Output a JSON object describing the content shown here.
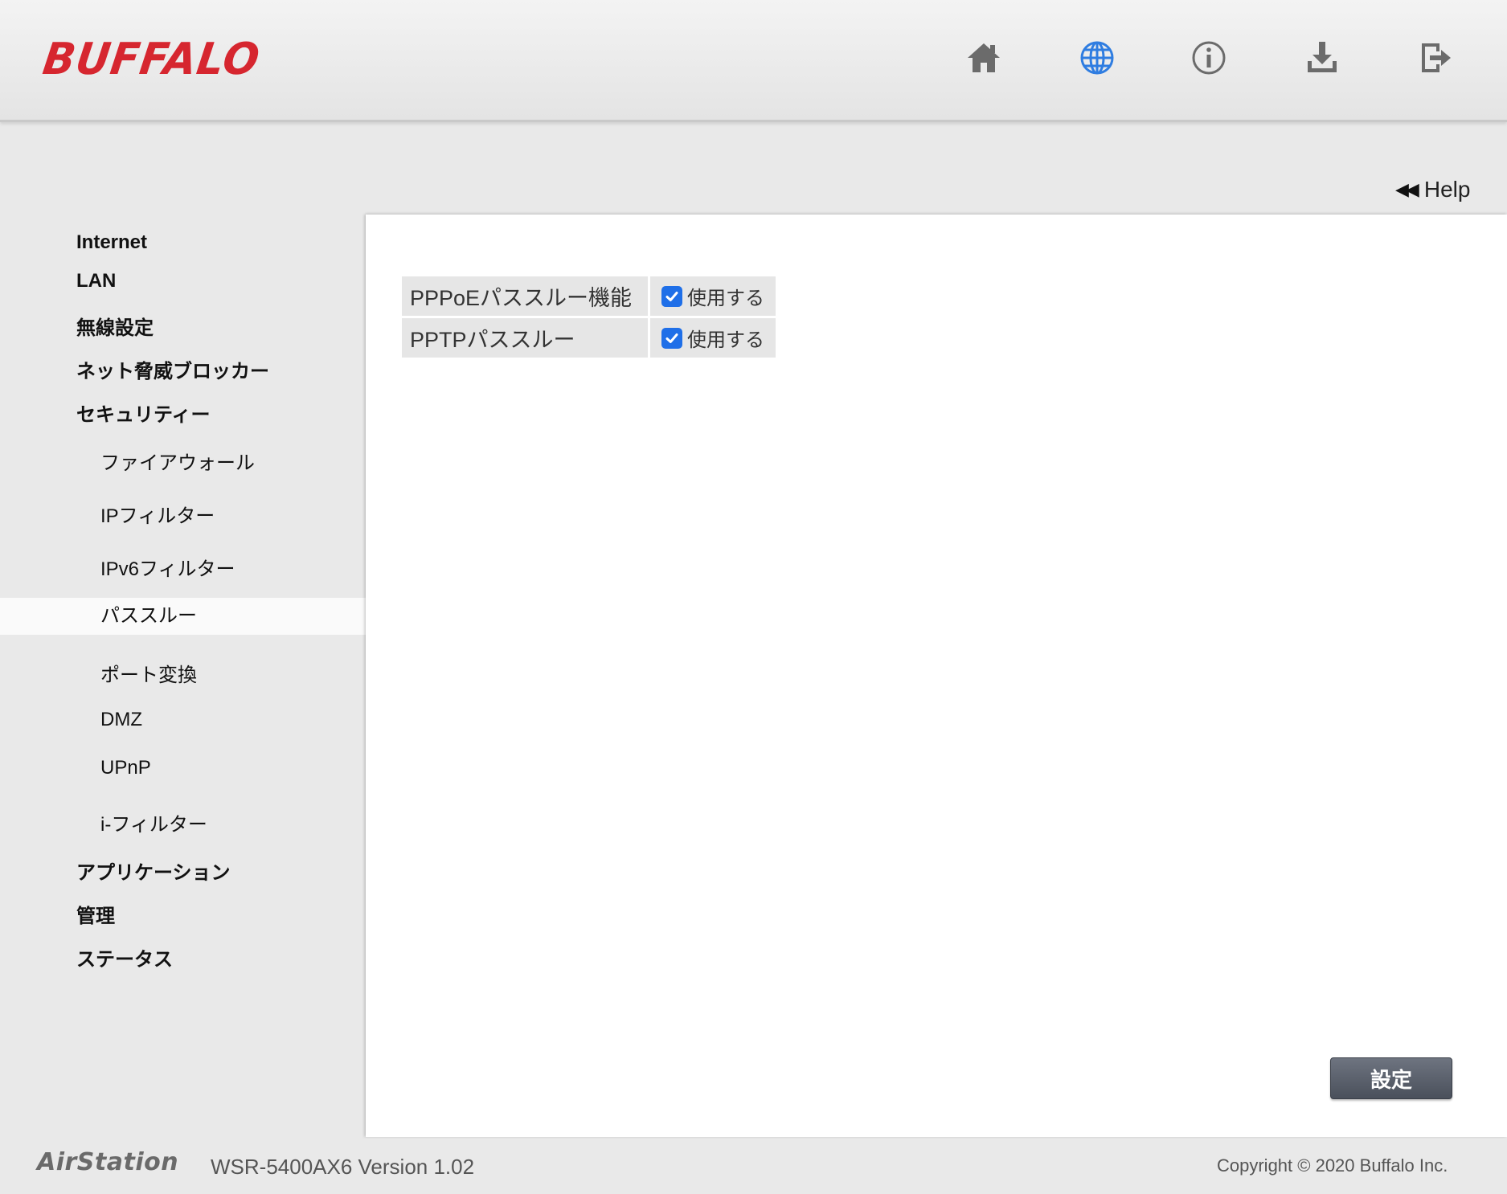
{
  "header": {
    "logo": "BUFFALO",
    "icons": {
      "home": "home-icon",
      "internet": "globe-icon",
      "info": "info-icon",
      "download": "download-icon",
      "logout": "logout-icon"
    },
    "active_icon_color": "#2f7de1",
    "icon_color": "#6b6b6b"
  },
  "help": {
    "label": "Help",
    "arrows": "◀◀"
  },
  "sidebar": {
    "items": [
      {
        "label": "Internet"
      },
      {
        "label": "LAN"
      },
      {
        "label": "無線設定"
      },
      {
        "label": "ネット脅威ブロッカー"
      },
      {
        "label": "セキュリティー"
      },
      {
        "label": "ファイアウォール"
      },
      {
        "label": "IPフィルター"
      },
      {
        "label": "IPv6フィルター"
      },
      {
        "label": "パススルー"
      },
      {
        "label": "ポート変換"
      },
      {
        "label": "DMZ"
      },
      {
        "label": "UPnP"
      },
      {
        "label": "i-フィルター"
      },
      {
        "label": "アプリケーション"
      },
      {
        "label": "管理"
      },
      {
        "label": "ステータス"
      }
    ],
    "active": "パススルー"
  },
  "settings": {
    "rows": [
      {
        "label": "PPPoEパススルー機能",
        "option": "使用する",
        "checked": true
      },
      {
        "label": "PPTPパススルー",
        "option": "使用する",
        "checked": true
      }
    ],
    "submit_label": "設定"
  },
  "footer": {
    "brand": "AirStation",
    "version": "WSR-5400AX6 Version 1.02",
    "copyright": "Copyright © 2020 Buffalo Inc."
  }
}
